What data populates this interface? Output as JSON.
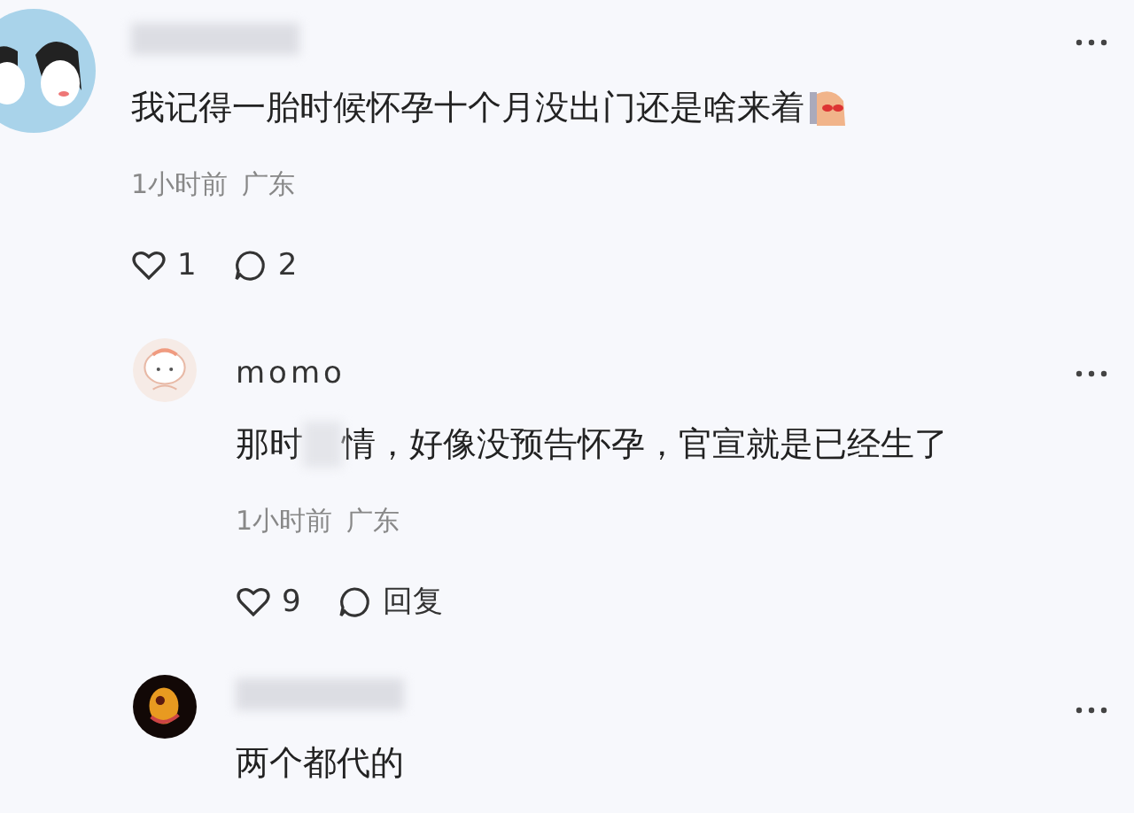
{
  "comments": [
    {
      "text": [
        "我记得一胎时候怀孕十个月没出门还是啥来着"
      ],
      "emoji": true,
      "time": "1小时前",
      "region": "广东",
      "likes": "1",
      "second_action": "2",
      "reply": false
    },
    {
      "author": "momo",
      "text": [
        "那时",
        "情，好像没预告怀孕，官宣就是已经生了"
      ],
      "time": "1小时前",
      "region": "广东",
      "likes": "9",
      "second_action": "回复",
      "reply": true
    },
    {
      "text": [
        "两个都代的"
      ],
      "reply": true
    }
  ]
}
